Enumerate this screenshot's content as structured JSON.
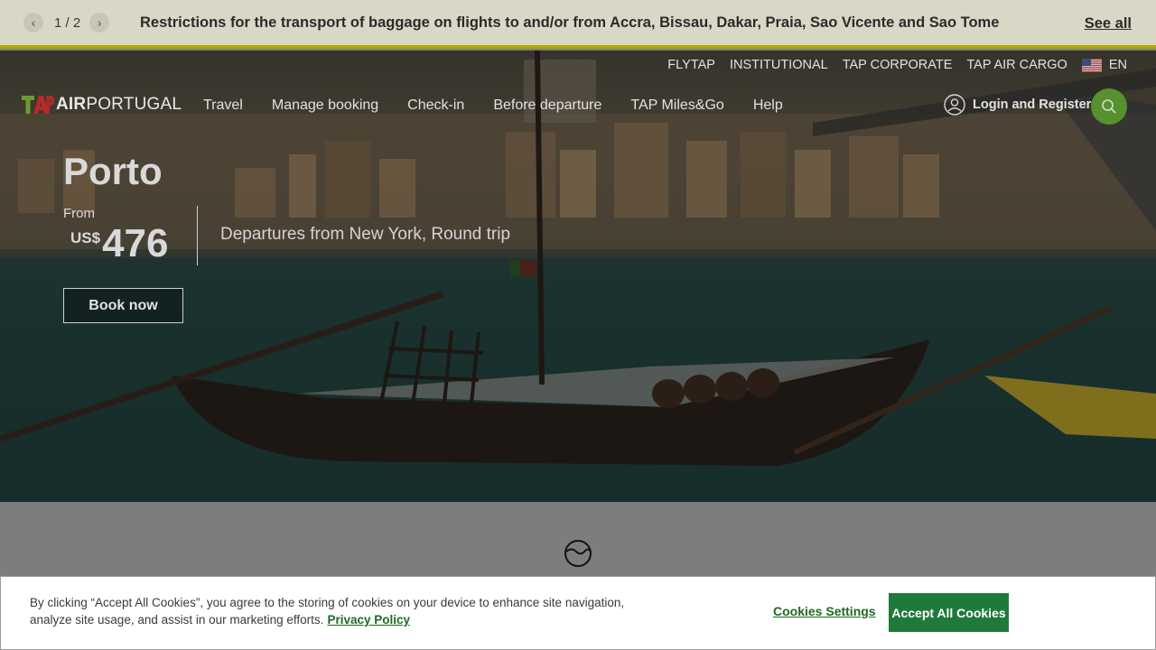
{
  "alert": {
    "prev_icon": "chevron-left-icon",
    "pager_text": "1 / 2",
    "next_icon": "chevron-right-icon",
    "message": "Restrictions for the transport of baggage on flights to and/or from Accra, Bissau, Dakar, Praia, Sao Vicente and Sao Tome",
    "see_all": "See all"
  },
  "top_links": {
    "flytap": "FLYTAP",
    "institutional": "INSTITUTIONAL",
    "corporate": "TAP CORPORATE",
    "cargo": "TAP AIR CARGO",
    "language": "EN",
    "flag_icon": "us-flag-icon"
  },
  "brand": {
    "air": "AIR",
    "portugal": "PORTUGAL"
  },
  "nav": {
    "travel": "Travel",
    "manage_booking": "Manage booking",
    "checkin": "Check-in",
    "before_departure": "Before departure",
    "miles": "TAP Miles&Go",
    "help": "Help"
  },
  "account": {
    "login": "Login and Register",
    "user_icon": "user-icon",
    "search_icon": "search-icon"
  },
  "hero": {
    "destination": "Porto",
    "from_label": "From",
    "currency": "US$",
    "price": "476",
    "trip": "Departures from New York, Round trip",
    "cta": "Book now"
  },
  "colors": {
    "accent_green": "#57912f",
    "alert_underline": "#b3a600",
    "cookie_green": "#1f7a3a"
  },
  "cookies": {
    "text": "By clicking “Accept All Cookies”, you agree to the storing of cookies on your device to enhance site navigation, analyze site usage, and assist in our marketing efforts.",
    "privacy_link": "Privacy Policy",
    "settings": "Cookies Settings",
    "accept": "Accept All Cookies"
  }
}
